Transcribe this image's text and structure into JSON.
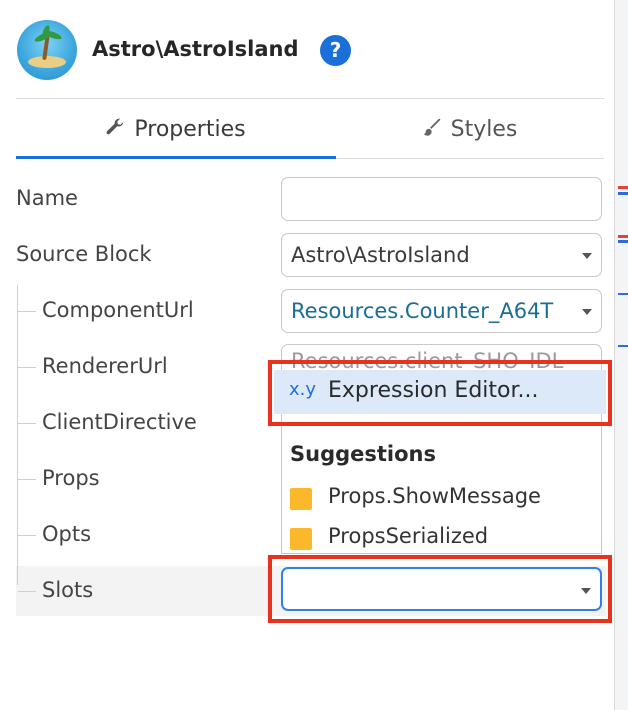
{
  "header": {
    "title": "Astro\\AstroIsland",
    "help_label": "?"
  },
  "tabs": [
    {
      "label": "Properties",
      "active": true,
      "icon": "wrench-icon"
    },
    {
      "label": "Styles",
      "active": false,
      "icon": "brush-icon"
    }
  ],
  "fields": {
    "name": {
      "label": "Name",
      "value": ""
    },
    "source_block": {
      "label": "Source Block",
      "value": "Astro\\AstroIsland"
    },
    "component_url": {
      "label": "ComponentUrl",
      "value": "Resources.Counter_A64T"
    },
    "renderer_url": {
      "label": "RendererUrl",
      "value": "Resources.client_SHO_IDL"
    },
    "client_directive": {
      "label": "ClientDirective"
    },
    "props": {
      "label": "Props"
    },
    "opts": {
      "label": "Opts"
    },
    "slots": {
      "label": "Slots",
      "value": ""
    }
  },
  "dropdown": {
    "expression_icon": "x.y",
    "expression_label": "Expression Editor...",
    "suggestions_title": "Suggestions",
    "suggestions": [
      "Props.ShowMessage",
      "PropsSerialized"
    ]
  },
  "colors": {
    "accent": "#1b6fd8",
    "highlight": "#dbe9f9",
    "annotation": "#e8321e",
    "suggestion_square": "#fbb82b",
    "link_value": "#1a6d96"
  }
}
